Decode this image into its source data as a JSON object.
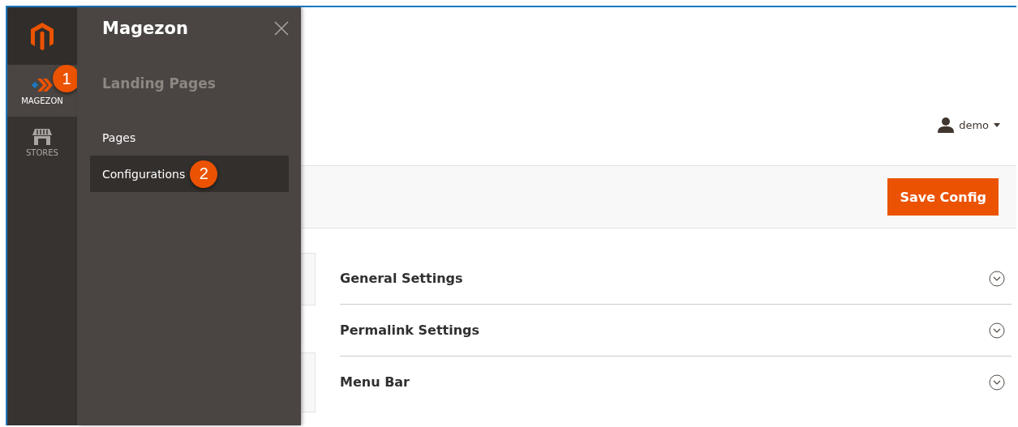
{
  "nav": {
    "items": [
      {
        "label": "MAGEZON",
        "kind": "magezon",
        "selected": true,
        "badge": "1"
      },
      {
        "label": "STORES",
        "kind": "stores",
        "selected": false
      }
    ]
  },
  "flyout": {
    "title": "Magezon",
    "group_title": "Landing Pages",
    "items": [
      {
        "label": "Pages",
        "selected": false
      },
      {
        "label": "Configurations",
        "selected": true,
        "badge": "2"
      }
    ]
  },
  "header": {
    "user": "demo"
  },
  "actions": {
    "save_button": "Save Config"
  },
  "sections": [
    {
      "title": "General Settings",
      "expanded": false
    },
    {
      "title": "Permalink Settings",
      "expanded": false
    },
    {
      "title": "Menu Bar",
      "expanded": false
    }
  ]
}
